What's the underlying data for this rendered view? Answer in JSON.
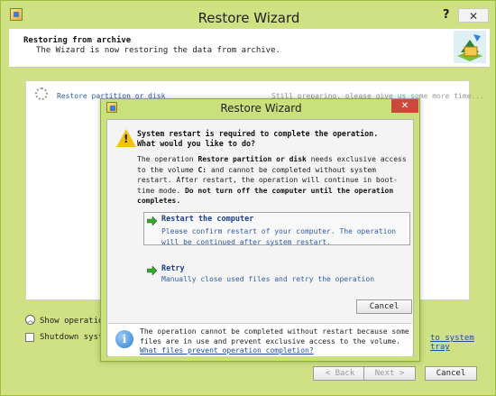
{
  "main_window": {
    "title": "Restore Wizard",
    "help_label": "?",
    "close_label": "✕",
    "header": {
      "heading": "Restoring from archive",
      "subheading": "The Wizard is now restoring the data from archive."
    },
    "operation": {
      "label": "Restore partition or disk",
      "status": "Still preparing, please give us some more time..."
    },
    "show_operations_label": "Show operations",
    "shutdown_label": "Shutdown system c",
    "tray_link": "to system tray",
    "buttons": {
      "back": "< Back",
      "next": "Next >",
      "cancel": "Cancel"
    }
  },
  "dialog": {
    "title": "Restore Wizard",
    "close_label": "✕",
    "warning_line1": "System restart is required to complete the operation.",
    "warning_line2": "What would you like to do?",
    "body": {
      "p1": "The operation ",
      "op_name": "Restore partition or disk",
      "p2": " needs exclusive access to the volume ",
      "volume": "C:",
      "p3": " and cannot be completed without system restart. After restart, the operation will continue in boot-time mode. ",
      "p4": "Do not turn off the computer until the operation completes."
    },
    "restart_option": {
      "label": "Restart the computer",
      "description": "Please confirm restart of your computer. The operation will be continued after system restart."
    },
    "retry_option": {
      "label": "Retry",
      "description": "Manually close used files and retry the operation"
    },
    "cancel_label": "Cancel",
    "info": {
      "text": "The operation cannot be completed without restart because some files are in use and prevent exclusive access to the volume.",
      "link": "What files prevent operation completion?"
    }
  },
  "colors": {
    "window_green": "#cfe183",
    "link_blue": "#1a4ea6",
    "close_red": "#c94a3a",
    "warning_yellow": "#f5c20a",
    "arrow_green": "#3aa535"
  },
  "icons": [
    "app-icon",
    "help-icon",
    "close-icon",
    "warning-icon",
    "arrow-right-icon",
    "info-icon",
    "chevron-up-icon",
    "spinner-icon"
  ]
}
